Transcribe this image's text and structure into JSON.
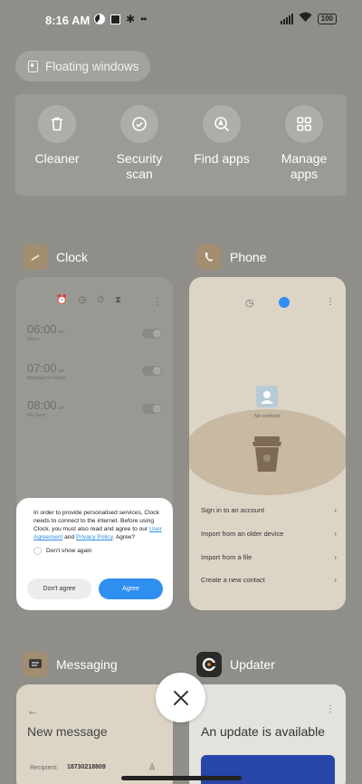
{
  "status": {
    "time": "8:16 AM",
    "battery": "100"
  },
  "floating": {
    "label": "Floating windows"
  },
  "actions": [
    {
      "label": "Cleaner",
      "icon": "trash-icon"
    },
    {
      "label": "Security scan",
      "icon": "shield-check-icon"
    },
    {
      "label": "Find apps",
      "icon": "search-a-icon"
    },
    {
      "label": "Manage apps",
      "icon": "grid-icon"
    }
  ],
  "apps": {
    "clock": {
      "name": "Clock"
    },
    "phone": {
      "name": "Phone"
    },
    "messaging": {
      "name": "Messaging"
    },
    "updater": {
      "name": "Updater"
    }
  },
  "clock": {
    "alarms": [
      {
        "time": "06:00",
        "ampm": "am",
        "sub": "Once"
      },
      {
        "time": "07:00",
        "ampm": "am",
        "sub": "Monday to Friday"
      },
      {
        "time": "08:00",
        "ampm": "am",
        "sub": "Go Gym"
      }
    ],
    "dialog": {
      "text1": "In order to provide personalised services, Clock needs to connect to the internet. Before using Clock, you must also read and agree to our",
      "link1": "User Agreement",
      "and": "and",
      "link2": "Privacy Policy",
      "text2": ". Agree?",
      "checkbox": "Don't show again",
      "disagree": "Don't agree",
      "agree": "Agree"
    }
  },
  "phone": {
    "no_contacts": "No contacts",
    "options": [
      "Sign in to an account",
      "Import from an older device",
      "Import from a file",
      "Create a new contact"
    ]
  },
  "messaging": {
    "title": "New message",
    "recipient_label": "Recipient:",
    "recipient": "18730218809"
  },
  "updater": {
    "title": "An update is available"
  },
  "colors": {
    "accent": "#2f8ff0",
    "background": "#8f8e89"
  }
}
